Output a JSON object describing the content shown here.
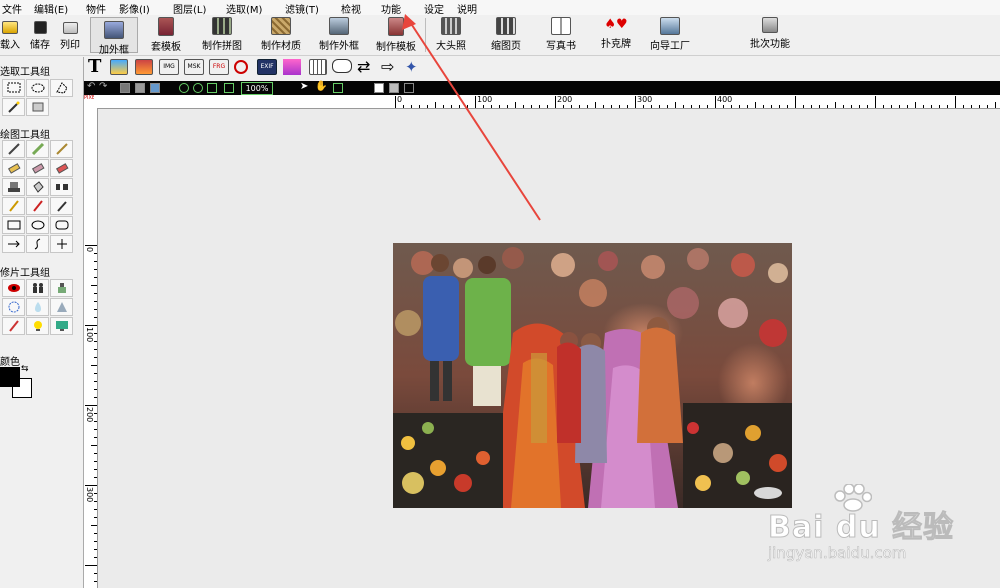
{
  "menu": {
    "items": [
      "文件",
      "编辑(E)",
      "物件",
      "影像(I)",
      "图层(L)",
      "选取(M)",
      "滤镜(T)",
      "检视",
      "功能",
      "设定",
      "说明"
    ]
  },
  "toolbar": {
    "load": "载入",
    "save": "储存",
    "print": "列印",
    "add_frame": "加外框",
    "template": "套模板",
    "make_collage": "制作拼图",
    "make_material": "制作材质",
    "make_frame": "制作外框",
    "make_template": "制作模板",
    "big_photo": "大头照",
    "thumbnail_page": "缩图页",
    "fax": "写真书",
    "poker": "扑克牌",
    "wizard": "向导工厂",
    "batch": "批次功能"
  },
  "toolbar2": {
    "exif_label": "EXIF",
    "img_label": "IMG",
    "msk_label": "MSK",
    "frg_label": "FRG"
  },
  "blackbar": {
    "zoom": "100%"
  },
  "ruler": {
    "unit": "PIXEL",
    "h_labels": [
      "0",
      "100",
      "200",
      "300",
      "400"
    ],
    "v_labels": [
      "0",
      "100",
      "200",
      "300"
    ]
  },
  "left_panel": {
    "select_group": "选取工具组",
    "draw_group": "绘图工具组",
    "retouch_group": "修片工具组",
    "color_label": "颜色"
  },
  "colors": {
    "foreground": "#000000",
    "background": "#ffffff",
    "annotation_arrow": "#e8453c"
  },
  "watermark": {
    "brand": "Bai du 经验",
    "url": "jingyan.baidu.com"
  }
}
